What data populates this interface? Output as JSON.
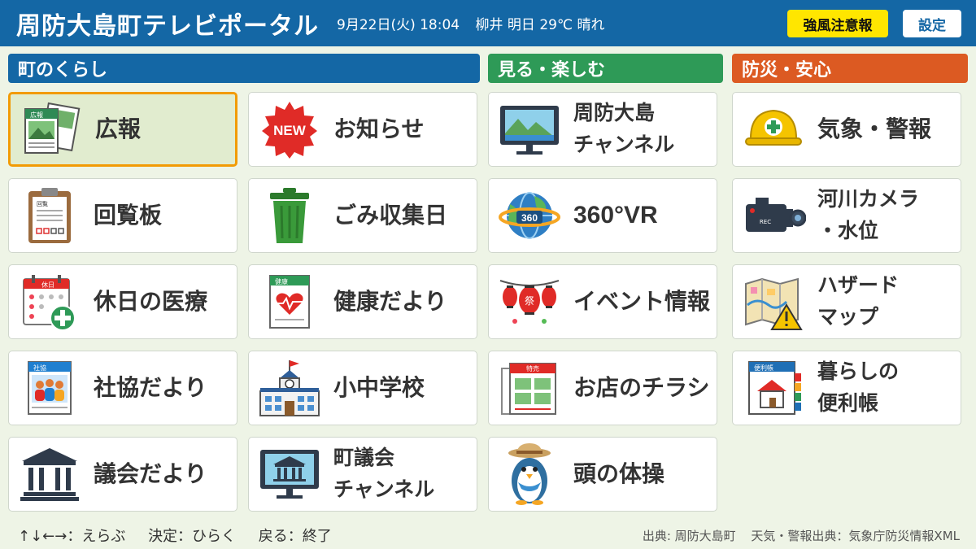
{
  "header": {
    "title": "周防大島町テレビポータル",
    "date": "9月22日(火) 18:04",
    "weather": "柳井 明日 29℃ 晴れ",
    "alert_label": "強風注意報",
    "settings_label": "設定",
    "colors": {
      "bar": "#1467a5",
      "alert": "#ffe600"
    }
  },
  "categories": {
    "life": {
      "label": "町のくらし",
      "color": "#1467a5"
    },
    "enjoy": {
      "label": "見る・楽しむ",
      "color": "#2e9a57"
    },
    "safety": {
      "label": "防災・安心",
      "color": "#dc5a22"
    }
  },
  "tiles": {
    "kouhou": "広報",
    "oshirase": "お知らせ",
    "channel": [
      "周防大島",
      "チャンネル"
    ],
    "kishou": "気象・警報",
    "kairanban": "回覧板",
    "gomi": "ごみ収集日",
    "vr": "360°VR",
    "kasen": [
      "河川カメラ",
      "・水位"
    ],
    "kyujitsu": "休日の医療",
    "kenkou": "健康だより",
    "event": "イベント情報",
    "hazard": [
      "ハザード",
      "マップ"
    ],
    "shakyo": "社協だより",
    "gakkou": "小中学校",
    "chirashi": "お店のチラシ",
    "benricho": [
      "暮らしの",
      "便利帳"
    ],
    "gikai": "議会だより",
    "gikai_ch": [
      "町議会",
      "チャンネル"
    ],
    "taisou": "頭の体操"
  },
  "icons": {
    "new_badge": "NEW",
    "vr_badge": "360",
    "kyujitsu_tag": "休日",
    "kenkou_tag": "健康",
    "shakyo_tag": "社協",
    "chirashi_tag": "特売",
    "benri_tag": "便利帳",
    "kouhou_tag": "広報",
    "kairan_tag": "回覧",
    "rec_tag": "REC",
    "festival_char": "祭"
  },
  "footer": {
    "nav": "↑↓←→：えらぶ",
    "enter": "決定：ひらく",
    "back": "戻る：終了",
    "source": "出典: 周防大島町",
    "weather_source": "天気・警報出典：気象庁防災情報XML"
  }
}
